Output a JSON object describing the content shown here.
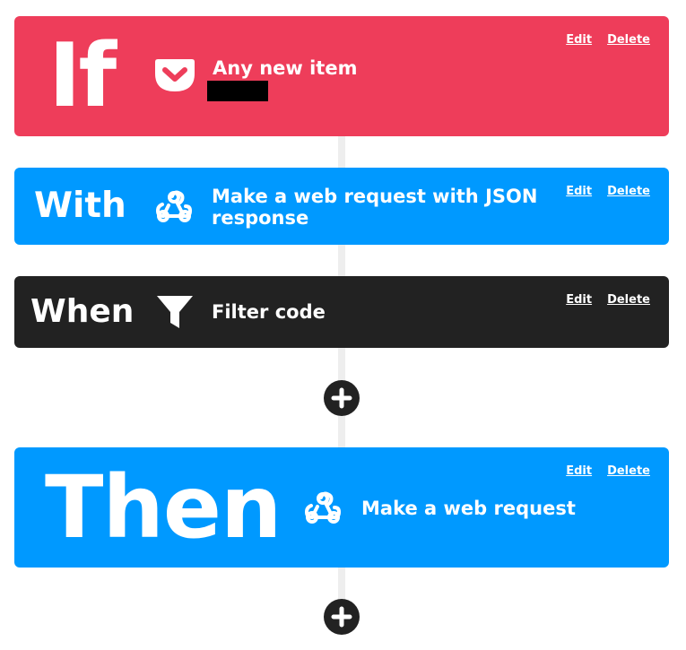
{
  "cards": {
    "if": {
      "keyword": "If",
      "icon": "pocket-icon",
      "title": "Any new item",
      "edit_label": "Edit",
      "delete_label": "Delete",
      "color": "#ee3d5a"
    },
    "with": {
      "keyword": "With",
      "icon": "webhooks-icon",
      "title": "Make a web request with JSON response",
      "edit_label": "Edit",
      "delete_label": "Delete",
      "color": "#0099ff"
    },
    "when": {
      "keyword": "When",
      "icon": "filter-icon",
      "title": "Filter code",
      "edit_label": "Edit",
      "delete_label": "Delete",
      "color": "#222222"
    },
    "then": {
      "keyword": "Then",
      "icon": "webhooks-icon",
      "title": "Make a web request",
      "edit_label": "Edit",
      "delete_label": "Delete",
      "color": "#0099ff"
    }
  },
  "add_buttons": [
    {
      "icon": "plus-icon"
    },
    {
      "icon": "plus-icon"
    }
  ]
}
